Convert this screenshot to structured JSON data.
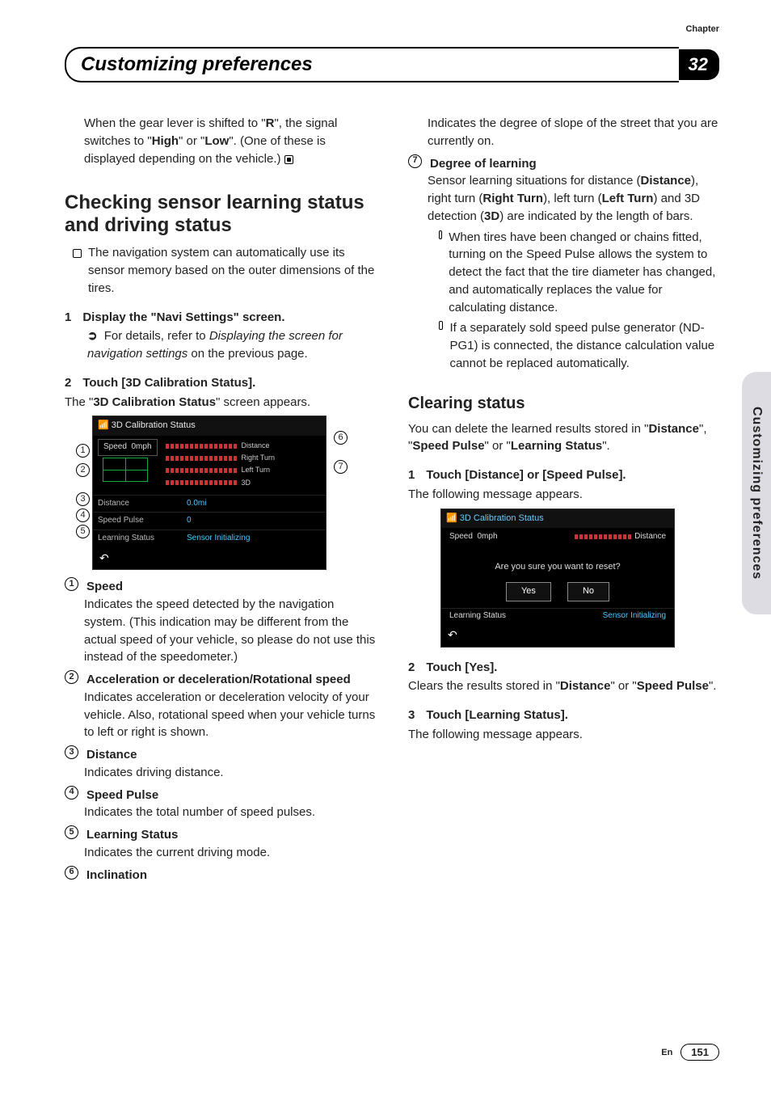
{
  "chapter_label": "Chapter",
  "chapter_number": "32",
  "header_title": "Customizing preferences",
  "side_tab": "Customizing preferences",
  "footer": {
    "lang": "En",
    "page": "151"
  },
  "left": {
    "intro": {
      "p1a": "When the gear lever is shifted to \"",
      "p1b": "R",
      "p1c": "\", the signal switches to \"",
      "p1d": "High",
      "p1e": "\" or \"",
      "p1f": "Low",
      "p1g": "\". (One of these is displayed depending on the vehicle.)"
    },
    "h1": "Checking sensor learning status and driving status",
    "note1": "The navigation system can automatically use its sensor memory based on the outer dimensions of the tires.",
    "step1": {
      "n": "1",
      "t": "Display the \"Navi Settings\" screen."
    },
    "step1_ref_a": "For details, refer to ",
    "step1_ref_i": "Displaying the screen for navigation settings",
    "step1_ref_b": " on the previous page.",
    "step2": {
      "n": "2",
      "t": "Touch [3D Calibration Status]."
    },
    "step2_body_a": "The \"",
    "step2_body_b": "3D Calibration Status",
    "step2_body_c": "\" screen appears.",
    "scrn": {
      "title": "3D Calibration Status",
      "speed_lbl": "Speed",
      "speed_val": "0mph",
      "bars": [
        "Distance",
        "Right Turn",
        "Left Turn",
        "3D"
      ],
      "rows": [
        {
          "lbl": "Distance",
          "val": "0.0mi"
        },
        {
          "lbl": "Speed Pulse",
          "val": "0"
        },
        {
          "lbl": "Learning Status",
          "val": "Sensor Initializing"
        }
      ],
      "back": "↶"
    },
    "callouts": [
      "1",
      "2",
      "3",
      "4",
      "5",
      "6",
      "7"
    ],
    "defs": [
      {
        "n": "1",
        "h": "Speed",
        "b": "Indicates the speed detected by the navigation system. (This indication may be different from the actual speed of your vehicle, so please do not use this instead of the speedometer.)"
      },
      {
        "n": "2",
        "h": "Acceleration or deceleration/Rotational speed",
        "b": "Indicates acceleration or deceleration velocity of your vehicle. Also, rotational speed when your vehicle turns to left or right is shown."
      },
      {
        "n": "3",
        "h": "Distance",
        "b": "Indicates driving distance."
      },
      {
        "n": "4",
        "h": "Speed Pulse",
        "b": "Indicates the total number of speed pulses."
      },
      {
        "n": "5",
        "h": "Learning Status",
        "b": "Indicates the current driving mode."
      },
      {
        "n": "6",
        "h": "Inclination",
        "b": ""
      }
    ]
  },
  "right": {
    "incl_body": "Indicates the degree of slope of the street that you are currently on.",
    "def7_n": "7",
    "def7_h": "Degree of learning",
    "def7_b_a": "Sensor learning situations for distance (",
    "def7_b_b": "Distance",
    "def7_b_c": "), right turn (",
    "def7_b_d": "Right Turn",
    "def7_b_e": "), left turn (",
    "def7_b_f": "Left Turn",
    "def7_b_g": ") and 3D detection (",
    "def7_b_h": "3D",
    "def7_b_i": ") are indicated by the length of bars.",
    "sub1": "When tires have been changed or chains fitted, turning on the Speed Pulse allows the system to detect the fact that the tire diameter has changed, and automatically replaces the value for calculating distance.",
    "sub2": "If a separately sold speed pulse generator (ND-PG1) is connected, the distance calculation value cannot be replaced automatically.",
    "h2": "Clearing status",
    "h2_body_a": "You can delete the learned results stored in \"",
    "h2_body_b": "Distance",
    "h2_body_c": "\", \"",
    "h2_body_d": "Speed Pulse",
    "h2_body_e": "\" or \"",
    "h2_body_f": "Learning Status",
    "h2_body_g": "\".",
    "cs_step1": {
      "n": "1",
      "t": "Touch [Distance] or [Speed Pulse]."
    },
    "cs_step1_body": "The following message appears.",
    "scrn2": {
      "title": "3D Calibration Status",
      "speed_lbl": "Speed",
      "speed_val": "0mph",
      "dist": "Distance",
      "prompt": "Are you sure you want to reset?",
      "yes": "Yes",
      "no": "No",
      "foot_l": "Learning Status",
      "foot_r": "Sensor Initializing",
      "back": "↶"
    },
    "cs_step2": {
      "n": "2",
      "t": "Touch [Yes]."
    },
    "cs_step2_body_a": "Clears the results stored in \"",
    "cs_step2_body_b": "Distance",
    "cs_step2_body_c": "\" or \"",
    "cs_step2_body_d": "Speed Pulse",
    "cs_step2_body_e": "\".",
    "cs_step3": {
      "n": "3",
      "t": "Touch [Learning Status]."
    },
    "cs_step3_body": "The following message appears."
  }
}
